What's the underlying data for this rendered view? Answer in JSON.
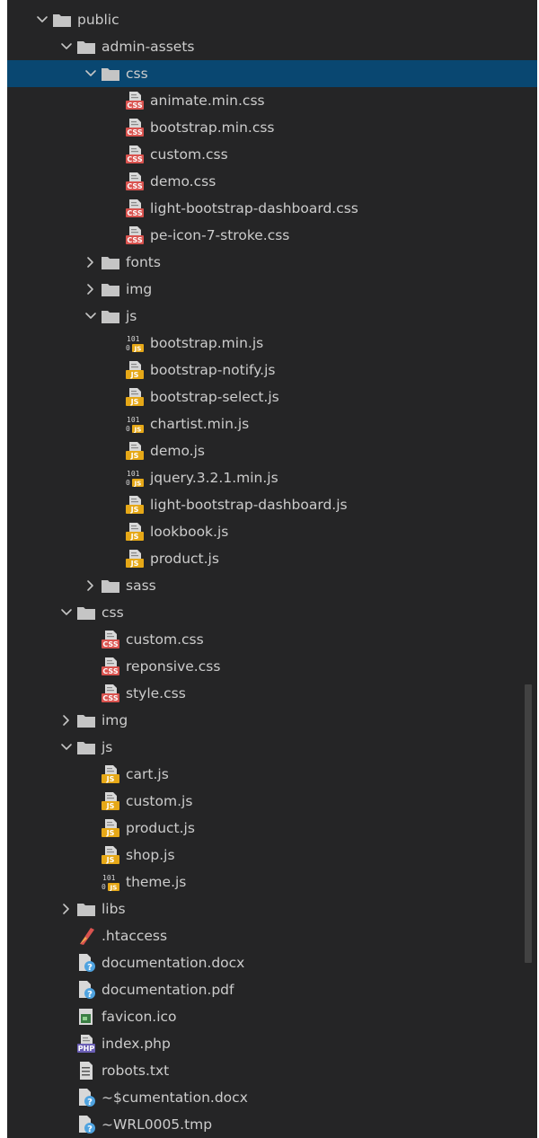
{
  "explorer": {
    "selected_path": "public/admin-assets/css",
    "items": [
      {
        "label": "public",
        "type": "folder",
        "depth": 0,
        "expanded": true,
        "icon": "folder-icon"
      },
      {
        "label": "admin-assets",
        "type": "folder",
        "depth": 1,
        "expanded": true,
        "icon": "folder-icon"
      },
      {
        "label": "css",
        "type": "folder",
        "depth": 2,
        "expanded": true,
        "selected": true,
        "icon": "folder-icon"
      },
      {
        "label": "animate.min.css",
        "type": "file",
        "depth": 3,
        "icon": "css-file-icon"
      },
      {
        "label": "bootstrap.min.css",
        "type": "file",
        "depth": 3,
        "icon": "css-file-icon"
      },
      {
        "label": "custom.css",
        "type": "file",
        "depth": 3,
        "icon": "css-file-icon"
      },
      {
        "label": "demo.css",
        "type": "file",
        "depth": 3,
        "icon": "css-file-icon"
      },
      {
        "label": "light-bootstrap-dashboard.css",
        "type": "file",
        "depth": 3,
        "icon": "css-file-icon"
      },
      {
        "label": "pe-icon-7-stroke.css",
        "type": "file",
        "depth": 3,
        "icon": "css-file-icon"
      },
      {
        "label": "fonts",
        "type": "folder",
        "depth": 2,
        "expanded": false,
        "icon": "folder-icon"
      },
      {
        "label": "img",
        "type": "folder",
        "depth": 2,
        "expanded": false,
        "icon": "folder-icon"
      },
      {
        "label": "js",
        "type": "folder",
        "depth": 2,
        "expanded": true,
        "icon": "folder-icon"
      },
      {
        "label": "bootstrap.min.js",
        "type": "file",
        "depth": 3,
        "icon": "minified-js-file-icon"
      },
      {
        "label": "bootstrap-notify.js",
        "type": "file",
        "depth": 3,
        "icon": "js-file-icon"
      },
      {
        "label": "bootstrap-select.js",
        "type": "file",
        "depth": 3,
        "icon": "js-file-icon"
      },
      {
        "label": "chartist.min.js",
        "type": "file",
        "depth": 3,
        "icon": "minified-js-file-icon"
      },
      {
        "label": "demo.js",
        "type": "file",
        "depth": 3,
        "icon": "js-file-icon"
      },
      {
        "label": "jquery.3.2.1.min.js",
        "type": "file",
        "depth": 3,
        "icon": "minified-js-file-icon"
      },
      {
        "label": "light-bootstrap-dashboard.js",
        "type": "file",
        "depth": 3,
        "icon": "js-file-icon"
      },
      {
        "label": "lookbook.js",
        "type": "file",
        "depth": 3,
        "icon": "js-file-icon"
      },
      {
        "label": "product.js",
        "type": "file",
        "depth": 3,
        "icon": "js-file-icon"
      },
      {
        "label": "sass",
        "type": "folder",
        "depth": 2,
        "expanded": false,
        "icon": "folder-icon"
      },
      {
        "label": "css",
        "type": "folder",
        "depth": 1,
        "expanded": true,
        "icon": "folder-icon"
      },
      {
        "label": "custom.css",
        "type": "file",
        "depth": 2,
        "icon": "css-file-icon"
      },
      {
        "label": "reponsive.css",
        "type": "file",
        "depth": 2,
        "icon": "css-file-icon"
      },
      {
        "label": "style.css",
        "type": "file",
        "depth": 2,
        "icon": "css-file-icon"
      },
      {
        "label": "img",
        "type": "folder",
        "depth": 1,
        "expanded": false,
        "icon": "folder-icon"
      },
      {
        "label": "js",
        "type": "folder",
        "depth": 1,
        "expanded": true,
        "icon": "folder-icon"
      },
      {
        "label": "cart.js",
        "type": "file",
        "depth": 2,
        "icon": "js-file-icon"
      },
      {
        "label": "custom.js",
        "type": "file",
        "depth": 2,
        "icon": "js-file-icon"
      },
      {
        "label": "product.js",
        "type": "file",
        "depth": 2,
        "icon": "js-file-icon"
      },
      {
        "label": "shop.js",
        "type": "file",
        "depth": 2,
        "icon": "js-file-icon"
      },
      {
        "label": "theme.js",
        "type": "file",
        "depth": 2,
        "icon": "minified-js-file-icon"
      },
      {
        "label": "libs",
        "type": "folder",
        "depth": 1,
        "expanded": false,
        "icon": "folder-icon"
      },
      {
        "label": ".htaccess",
        "type": "file",
        "depth": 1,
        "icon": "htaccess-file-icon"
      },
      {
        "label": "documentation.docx",
        "type": "file",
        "depth": 1,
        "icon": "unknown-file-icon"
      },
      {
        "label": "documentation.pdf",
        "type": "file",
        "depth": 1,
        "icon": "unknown-file-icon"
      },
      {
        "label": "favicon.ico",
        "type": "file",
        "depth": 1,
        "icon": "image-file-icon"
      },
      {
        "label": "index.php",
        "type": "file",
        "depth": 1,
        "icon": "php-file-icon"
      },
      {
        "label": "robots.txt",
        "type": "file",
        "depth": 1,
        "icon": "text-file-icon"
      },
      {
        "label": "~$cumentation.docx",
        "type": "file",
        "depth": 1,
        "icon": "unknown-file-icon"
      },
      {
        "label": "~WRL0005.tmp",
        "type": "file",
        "depth": 1,
        "icon": "unknown-file-icon"
      }
    ]
  },
  "icon_badges": {
    "css": "CSS",
    "js": "JS",
    "minified_top": "101",
    "minified_bottom": "0",
    "php": "PHP",
    "unknown": "?"
  },
  "colors": {
    "panel_bg": "#252526",
    "selected_bg": "#094771",
    "text": "#cccccc",
    "folder": "#c5c5c5",
    "css_badge": "#d9534f",
    "js_badge": "#e6a817",
    "php_badge": "#6b5fb5",
    "unknown_badge": "#4fa3e0"
  }
}
